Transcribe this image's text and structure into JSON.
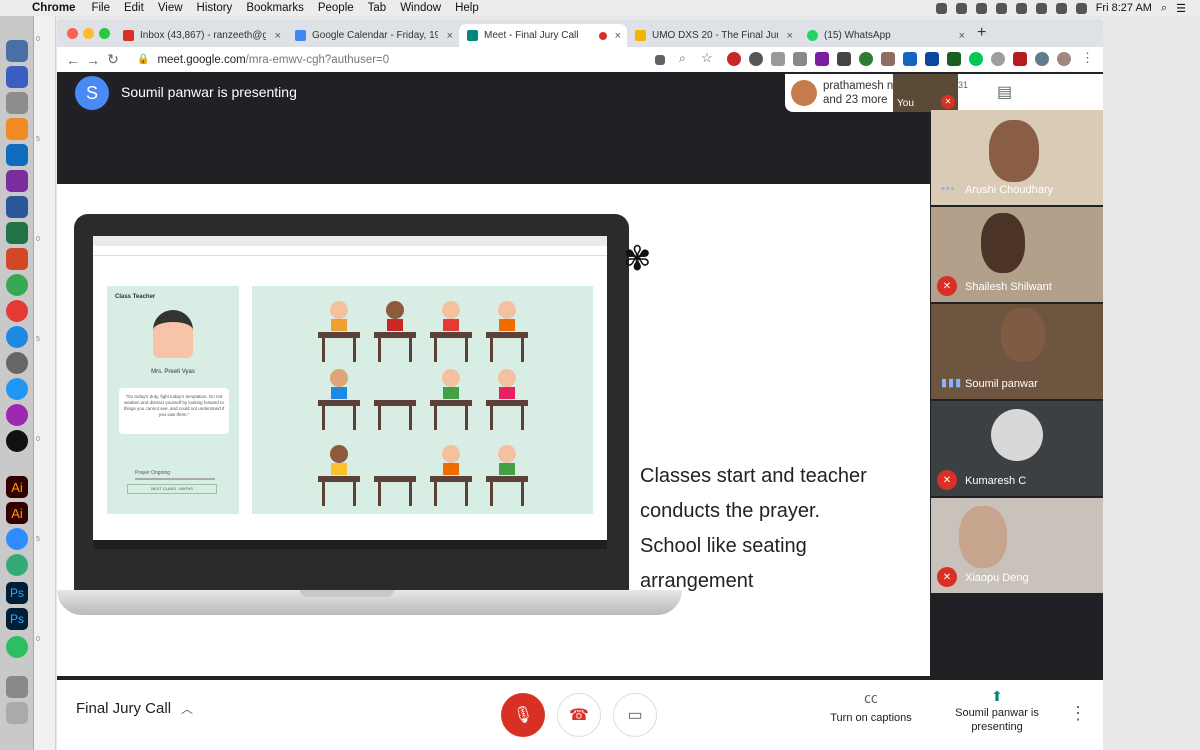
{
  "menubar": {
    "app": "Chrome",
    "items": [
      "File",
      "Edit",
      "View",
      "History",
      "Bookmarks",
      "People",
      "Tab",
      "Window",
      "Help"
    ],
    "clock": "Fri 8:27 AM"
  },
  "tabs": [
    {
      "label": "Inbox (43,867) - ranzeeth@gm",
      "color": "#d93025"
    },
    {
      "label": "Google Calendar - Friday, 19 J",
      "color": "#4285f4"
    },
    {
      "label": "Meet - Final Jury Call",
      "color": "#00897b"
    },
    {
      "label": "UMO DXS 20 - The Final Jury",
      "color": "#f4b400"
    },
    {
      "label": "(15) WhatsApp",
      "color": "#25d366"
    }
  ],
  "toolbar": {
    "url_host": "meet.google.com",
    "url_path": "/mra-emwv-cgh?authuser=0"
  },
  "presenter": {
    "avatar_letter": "S",
    "text": "Soumil panwar is presenting"
  },
  "slide": {
    "lines": [
      "Classes start and teacher",
      "conducts the prayer.",
      "School like seating",
      "arrangement"
    ],
    "inner": {
      "class_teacher": "Class Teacher",
      "teacher_name": "Mrs. Preeti Vyas",
      "quote": "\"Do today's duty, fight today's temptation. Do not weaken and distract yourself by looking forward to things you cannot see, and could not understand if you saw them.\"",
      "prayer_status": "Prayer Ongoing",
      "next_class": "NEXT CLASS : MATHS"
    }
  },
  "participants_card": {
    "name": "prathamesh nar...",
    "more": "and 23 more",
    "count": "31",
    "you_label": "You"
  },
  "tiles": [
    {
      "name": "Arushi Choudhary",
      "state": "speaking",
      "bg": "#d9cbb6",
      "face": "#8a5d45"
    },
    {
      "name": "Shailesh Shilwant",
      "state": "muted",
      "bg": "#b3a08a",
      "face": "#4b3425"
    },
    {
      "name": "Soumil panwar",
      "state": "speaking",
      "bg": "#6e5540",
      "face": "#7f5b43"
    },
    {
      "name": "Kumaresh C",
      "state": "muted",
      "bg": "#3c4043",
      "face": "#d8d8d8"
    },
    {
      "name": "Xiaopu Deng",
      "state": "muted",
      "bg": "#c9c2bb",
      "face": "#c6a48d"
    }
  ],
  "bottom": {
    "meeting_title": "Final Jury Call",
    "captions_label": "Turn on captions",
    "presenting_label": "Soumil panwar is presenting"
  }
}
